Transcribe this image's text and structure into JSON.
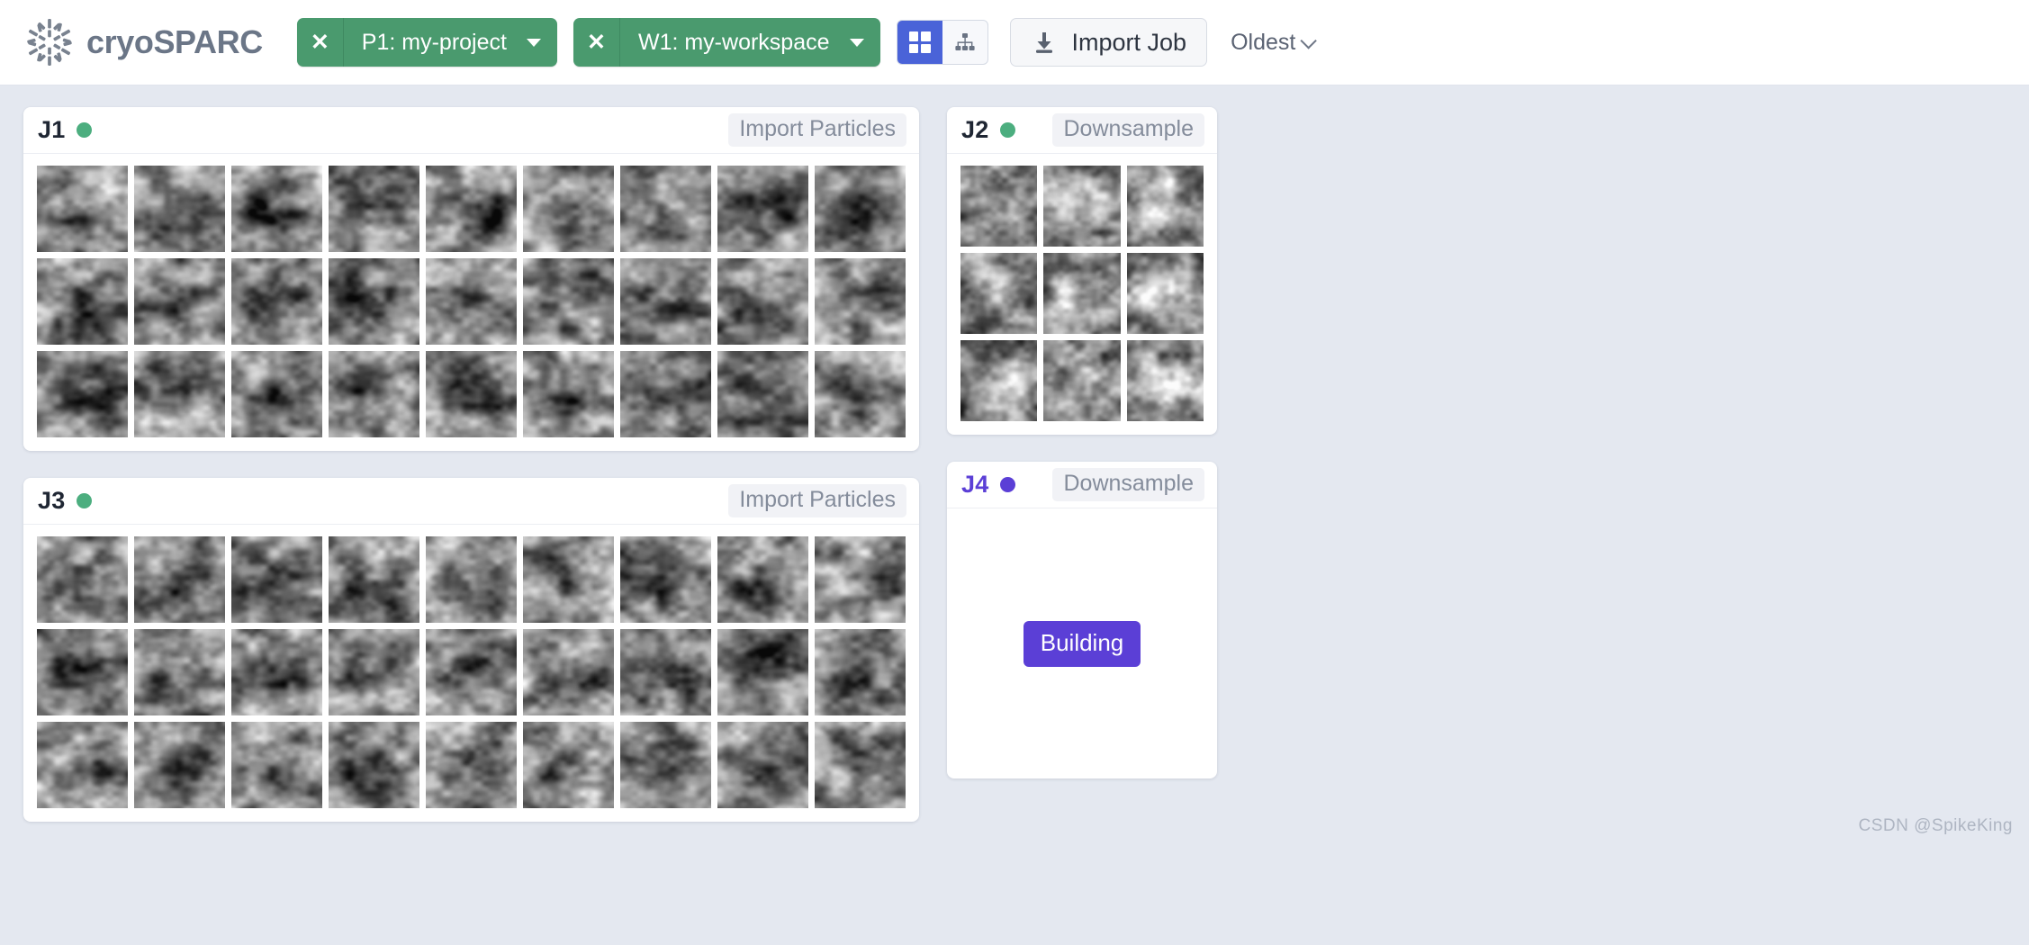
{
  "app": {
    "brand_name": "cryoSPARC",
    "logo_icon": "cryosparc-pinwheel-logo"
  },
  "header": {
    "project_tab": {
      "close_label": "✕",
      "label": "P1: my-project",
      "caret_icon": "caret-down-icon",
      "color": "#4a9a6e"
    },
    "workspace_tab": {
      "close_label": "✕",
      "label": "W1: my-workspace",
      "caret_icon": "caret-down-icon",
      "color": "#4a9a6e"
    },
    "view_toggle": {
      "grid_icon": "grid-view-icon",
      "tree_icon": "tree-view-icon",
      "active": "grid",
      "active_color": "#4a63d8"
    },
    "import_job": {
      "icon": "download-icon",
      "label": "Import Job"
    },
    "sort": {
      "label": "Oldest",
      "chevron_icon": "chevron-down-icon"
    }
  },
  "jobs": [
    {
      "id": "J1",
      "status_color": "#4cae7f",
      "status_icon": "status-dot-complete",
      "type": "Import Particles",
      "layout": "grid-9x3",
      "thumb_count": 27,
      "thumb_kind": "particle-micrograph"
    },
    {
      "id": "J2",
      "status_color": "#4cae7f",
      "status_icon": "status-dot-complete",
      "type": "Downsample",
      "layout": "grid-3x3",
      "thumb_count": 9,
      "thumb_kind": "particle-micrograph"
    },
    {
      "id": "J3",
      "status_color": "#4cae7f",
      "status_icon": "status-dot-complete",
      "type": "Import Particles",
      "layout": "grid-9x3",
      "thumb_count": 27,
      "thumb_kind": "particle-micrograph"
    },
    {
      "id": "J4",
      "status_color": "#5b3fd6",
      "status_icon": "status-dot-building",
      "type": "Downsample",
      "layout": "empty",
      "badge": "Building",
      "badge_color": "#5b3fd6"
    }
  ],
  "watermark": "CSDN @SpikeKing"
}
